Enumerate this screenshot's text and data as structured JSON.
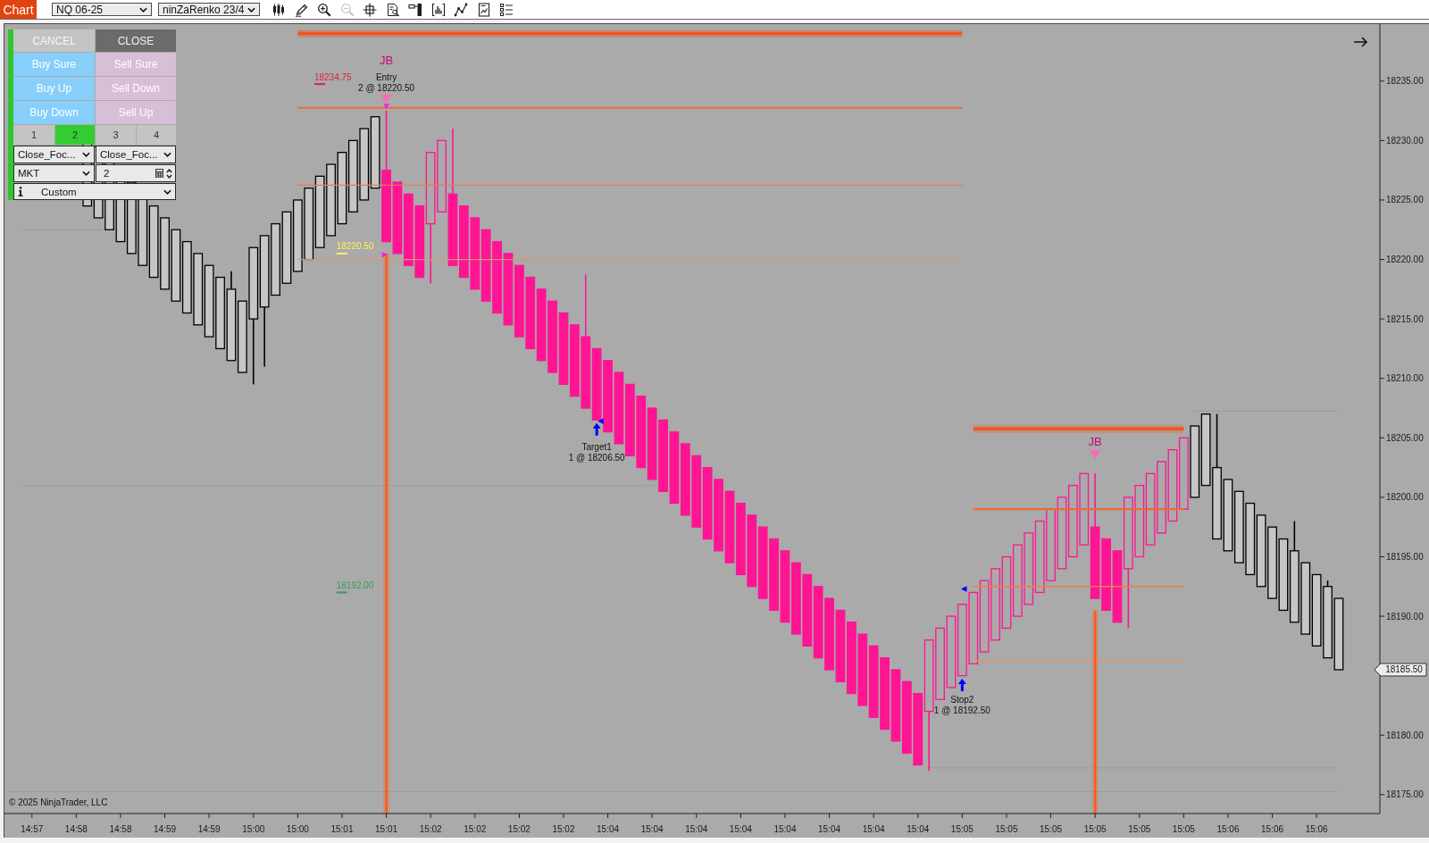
{
  "toolbar": {
    "tab": "Chart",
    "instrument": "NQ 06-25",
    "bar_type": "ninZaRenko 23/4",
    "tools": [
      {
        "disabled": false
      },
      {
        "disabled": false
      },
      {
        "disabled": false
      },
      {
        "disabled": true
      },
      {
        "disabled": false
      },
      {
        "disabled": false
      },
      {
        "disabled": false
      },
      {
        "disabled": false
      },
      {
        "disabled": false
      },
      {
        "disabled": false
      },
      {
        "disabled": false
      }
    ]
  },
  "order_panel": {
    "action_buttons": [
      {
        "label": "CANCEL",
        "kind": "cancel"
      },
      {
        "label": "CLOSE",
        "kind": "close"
      }
    ],
    "buy_buttons": [
      "Buy Sure",
      "Buy Up",
      "Buy Down"
    ],
    "sell_buttons": [
      "Sell Sure",
      "Sell Down",
      "Sell Up"
    ],
    "quantity_presets": [
      {
        "label": "1",
        "selected": false
      },
      {
        "label": "2",
        "selected": true
      },
      {
        "label": "3",
        "selected": false
      },
      {
        "label": "4",
        "selected": false
      }
    ],
    "close_modes": [
      "Close_Foc...",
      "Close_Foc..."
    ],
    "order_type": "MKT",
    "quantity": "2",
    "template": "Custom"
  },
  "chart": {
    "signals": [
      "JB",
      "JB"
    ],
    "executions": [
      {
        "title": "Entry",
        "detail": "2 @ 18220.50"
      },
      {
        "title": "Target1",
        "detail": "1 @ 18206.50"
      },
      {
        "title": "Stop2",
        "detail": "1 @ 18192.50"
      }
    ],
    "price_tags": [
      {
        "text": "18234.75",
        "color": "#d62839"
      },
      {
        "text": "18220.50",
        "color": "#fff35c"
      },
      {
        "text": "18192.00",
        "color": "#3a9a5a"
      }
    ],
    "last_price": "18185.50",
    "price_axis": [
      "18235.00",
      "18230.00",
      "18225.00",
      "18220.00",
      "18215.00",
      "18210.00",
      "18205.00",
      "18200.00",
      "18195.00",
      "18190.00",
      "18180.00",
      "18175.00"
    ],
    "time_axis": [
      "14:57",
      "14:58",
      "14:58",
      "14:59",
      "14:59",
      "15:00",
      "15:00",
      "15:01",
      "15:01",
      "15:02",
      "15:02",
      "15:02",
      "15:02",
      "15:04",
      "15:04",
      "15:04",
      "15:04",
      "15:04",
      "15:04",
      "15:04",
      "15:04",
      "15:05",
      "15:05",
      "15:05",
      "15:05",
      "15:05",
      "15:05",
      "15:06",
      "15:06",
      "15:06"
    ],
    "copyright": "© 2025 NinjaTrader, LLC"
  }
}
